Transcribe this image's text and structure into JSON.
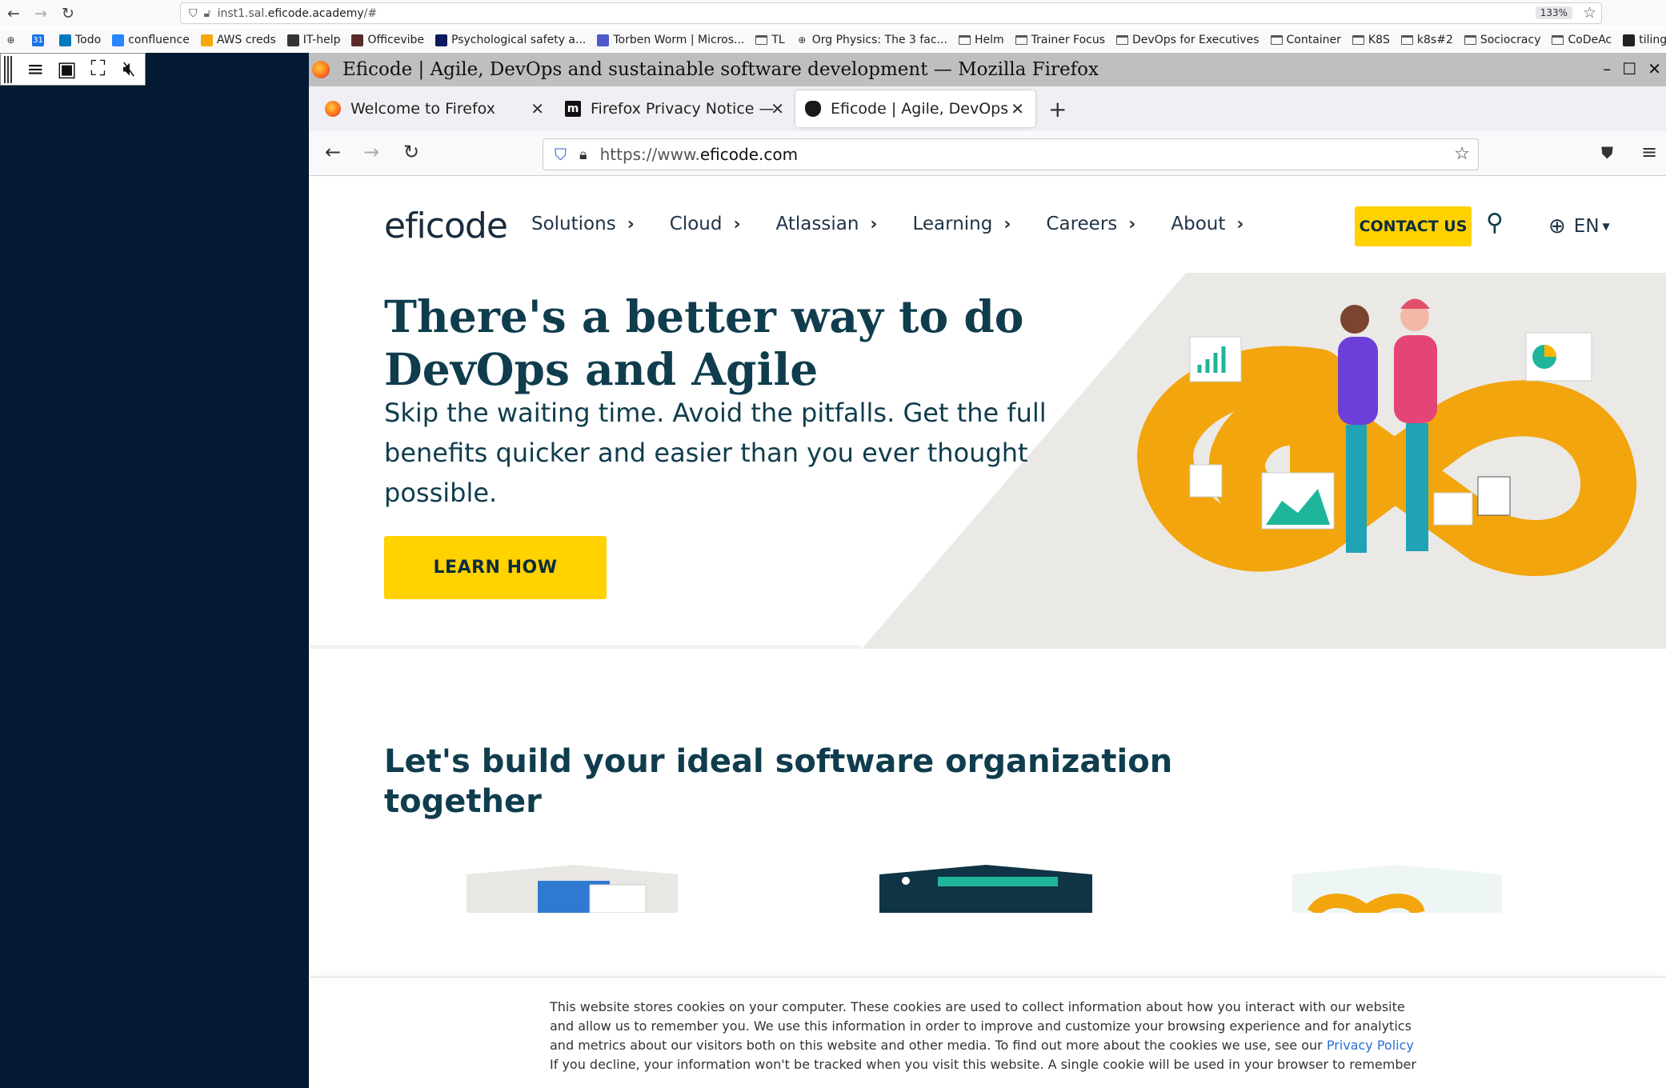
{
  "host": {
    "url_prefix": "inst1.sal.",
    "url_domain": "eficode.academy",
    "url_suffix": "/#",
    "zoom": "133%",
    "bookmarks": [
      {
        "label": "Todo",
        "icon": "trello-icon"
      },
      {
        "label": "confluence",
        "icon": "confluence-icon"
      },
      {
        "label": "AWS creds",
        "icon": "aws-icon"
      },
      {
        "label": "IT-help",
        "icon": "it-help-icon"
      },
      {
        "label": "Officevibe",
        "icon": "officevibe-icon"
      },
      {
        "label": "Psychological safety a...",
        "icon": "bookmark-icon"
      },
      {
        "label": "Torben Worm | Micros...",
        "icon": "teams-icon"
      },
      {
        "label": "TL",
        "icon": "folder-icon"
      },
      {
        "label": "Org Physics: The 3 fac...",
        "icon": "globe-icon"
      },
      {
        "label": "Helm",
        "icon": "folder-icon"
      },
      {
        "label": "Trainer Focus",
        "icon": "folder-icon"
      },
      {
        "label": "DevOps for Executives",
        "icon": "folder-icon"
      },
      {
        "label": "Container",
        "icon": "folder-icon"
      },
      {
        "label": "K8S",
        "icon": "folder-icon"
      },
      {
        "label": "k8s#2",
        "icon": "folder-icon"
      },
      {
        "label": "Sociocracy",
        "icon": "folder-icon"
      },
      {
        "label": "CoDeAc",
        "icon": "folder-icon"
      },
      {
        "label": "tiling for gnome",
        "icon": "github-icon"
      }
    ]
  },
  "window": {
    "title": "Eficode | Agile, DevOps and sustainable software development — Mozilla Firefox"
  },
  "tabs": [
    {
      "label": "Welcome to Firefox",
      "color": "#ff7139"
    },
    {
      "label": "Firefox Privacy Notice — M",
      "color": "#222222"
    },
    {
      "label": "Eficode | Agile, DevOps a",
      "color": "#1a1a1a"
    }
  ],
  "address": {
    "prefix": "https://www.",
    "domain": "eficode.com"
  },
  "site": {
    "logo": "eficode",
    "menu": [
      "Solutions",
      "Cloud",
      "Atlassian",
      "Learning",
      "Careers",
      "About"
    ],
    "contact": "CONTACT US",
    "lang": "EN",
    "hero_title": "There's a better way to do DevOps and Agile",
    "hero_sub": "Skip the waiting time. Avoid the pitfalls. Get the full benefits quicker and easier than you ever thought possible.",
    "learn_button": "LEARN HOW",
    "section_title": "Let's build your ideal software organization together"
  },
  "cookie": {
    "p1_text": "This website stores cookies on your computer. These cookies are used to collect information about how you interact with our website and allow us to remember you. We use this information in order to improve and customize your browsing experience and for analytics and metrics about our visitors both on this website and other media. To find out more about the cookies we use, see our ",
    "p1_link": "Privacy Policy",
    "p2_text": "If you decline, your information won't be tracked when you visit this website. A single cookie will be used in your browser to remember"
  },
  "colors": {
    "accent_yellow": "#ffd200",
    "heading_teal": "#0f3d4d",
    "desktop_navy": "#041a33"
  }
}
